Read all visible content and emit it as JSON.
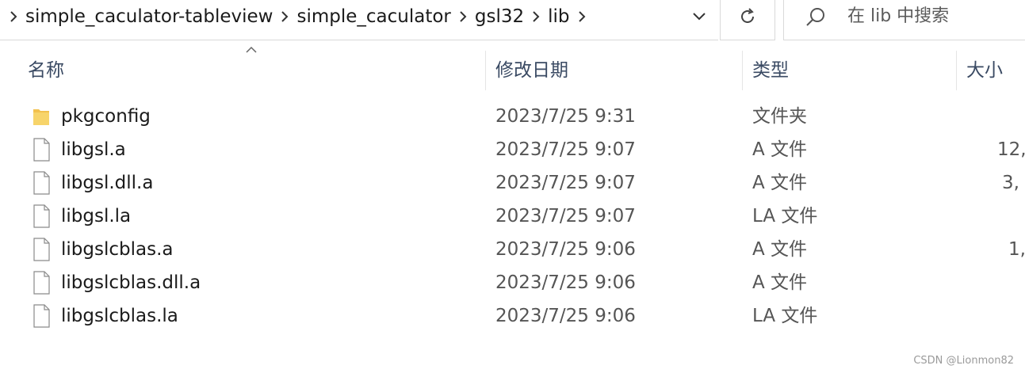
{
  "breadcrumb": {
    "items": [
      {
        "label": "simple_caculator-tableview"
      },
      {
        "label": "simple_caculator"
      },
      {
        "label": "gsl32"
      },
      {
        "label": "lib"
      }
    ]
  },
  "search": {
    "placeholder": "在 lib 中搜索"
  },
  "columns": {
    "name": "名称",
    "date": "修改日期",
    "type": "类型",
    "size": "大小"
  },
  "files": [
    {
      "name": "pkgconfig",
      "date": "2023/7/25 9:31",
      "type": "文件夹",
      "size": "",
      "icon": "folder-icon"
    },
    {
      "name": "libgsl.a",
      "date": "2023/7/25 9:07",
      "type": "A 文件",
      "size": "12,",
      "icon": "file-icon"
    },
    {
      "name": "libgsl.dll.a",
      "date": "2023/7/25 9:07",
      "type": "A 文件",
      "size": "3,",
      "icon": "file-icon"
    },
    {
      "name": "libgsl.la",
      "date": "2023/7/25 9:07",
      "type": "LA 文件",
      "size": "",
      "icon": "file-icon"
    },
    {
      "name": "libgslcblas.a",
      "date": "2023/7/25 9:06",
      "type": "A 文件",
      "size": "1,",
      "icon": "file-icon"
    },
    {
      "name": "libgslcblas.dll.a",
      "date": "2023/7/25 9:06",
      "type": "A 文件",
      "size": "",
      "icon": "file-icon"
    },
    {
      "name": "libgslcblas.la",
      "date": "2023/7/25 9:06",
      "type": "LA 文件",
      "size": "",
      "icon": "file-icon"
    }
  ],
  "watermark": "CSDN @Lionmon82",
  "colors": {
    "folder": "#f2c14e",
    "header_text": "#3a4a63",
    "divider": "#d9d9d9"
  }
}
